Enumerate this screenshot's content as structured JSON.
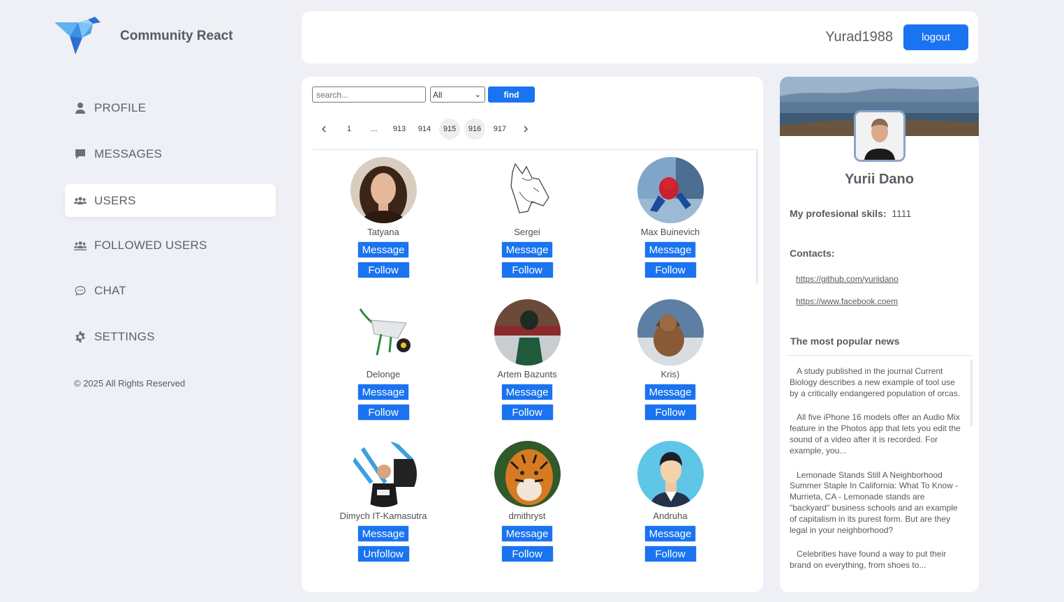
{
  "brand": {
    "name": "Community React",
    "logo_icon": "origami-bird-icon"
  },
  "nav": [
    {
      "label": "PROFILE",
      "icon": "person-icon"
    },
    {
      "label": "MESSAGES",
      "icon": "chat-bubble-icon"
    },
    {
      "label": "USERS",
      "icon": "users-icon",
      "active": true
    },
    {
      "label": "FOLLOWED USERS",
      "icon": "group-icon"
    },
    {
      "label": "CHAT",
      "icon": "chat-dots-icon"
    },
    {
      "label": "SETTINGS",
      "icon": "gear-icon"
    }
  ],
  "copyright": "© 2025 All Rights Reserved",
  "header": {
    "username": "Yurad1988",
    "logout_label": "logout"
  },
  "search": {
    "placeholder": "search...",
    "filter_value": "All",
    "find_label": "find"
  },
  "pagination": {
    "pages": [
      "1",
      "...",
      "913",
      "914",
      "915",
      "916",
      "917"
    ],
    "current": "916",
    "prev_icon": "chevron-left-icon",
    "next_icon": "chevron-right-icon"
  },
  "users": [
    {
      "name": "Tatyana",
      "message_label": "Message",
      "follow_label": "Follow"
    },
    {
      "name": "Sergei",
      "message_label": "Message",
      "follow_label": "Follow"
    },
    {
      "name": "Max Buinevich",
      "message_label": "Message",
      "follow_label": "Follow"
    },
    {
      "name": "Delonge",
      "message_label": "Message",
      "follow_label": "Follow"
    },
    {
      "name": "Artem Bazunts",
      "message_label": "Message",
      "follow_label": "Follow"
    },
    {
      "name": "Kris)",
      "message_label": "Message",
      "follow_label": "Follow"
    },
    {
      "name": "Dimych IT-Kamasutra",
      "message_label": "Message",
      "follow_label": "Unfollow"
    },
    {
      "name": "dmithryst",
      "message_label": "Message",
      "follow_label": "Follow"
    },
    {
      "name": "Andruha",
      "message_label": "Message",
      "follow_label": "Follow"
    }
  ],
  "profile": {
    "name": "Yurii Dano",
    "skills_label": "My profesional skils:",
    "skills_value": "1111",
    "contacts_label": "Contacts:",
    "contacts": [
      "https://github.com/yuriidano",
      "https://www.facebook.coem"
    ],
    "news_title": "The most popular news",
    "news": [
      "A study published in the journal Current Biology describes a new example of tool use by a critically endangered population of orcas.",
      "All five iPhone 16 models offer an Audio Mix feature in the Photos app that lets you edit the sound of a video after it is recorded. For example, you...",
      "Lemonade Stands Still A Neighborhood Summer Staple In California: What To Know - Murrieta, CA - Lemonade stands are \"backyard\" business schools and an example of capitalism in its purest form. But are they legal in your neighborhood?",
      "Celebrities have found a way to put their brand on everything, from shoes to..."
    ]
  },
  "colors": {
    "accent": "#1a73f0",
    "background": "#eef0f5",
    "panel": "#ffffff"
  }
}
